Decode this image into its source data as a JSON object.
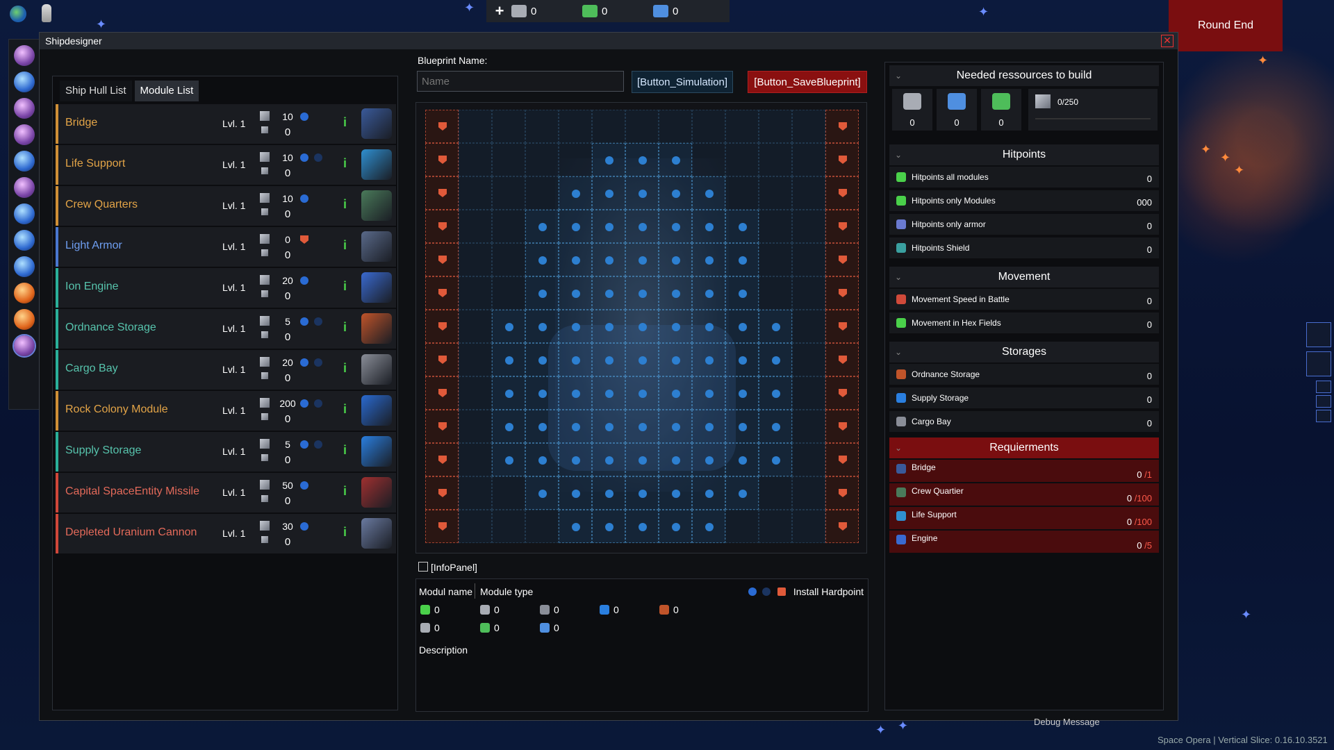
{
  "topbar": {
    "resources": [
      {
        "name": "metal",
        "value": "0",
        "color": "#a8acb4"
      },
      {
        "name": "biomass",
        "value": "0",
        "color": "#4ebd5a"
      },
      {
        "name": "crystal",
        "value": "0",
        "color": "#4f8fe0"
      }
    ],
    "round_end": "Round End"
  },
  "window": {
    "title": "Shipdesigner"
  },
  "tabs": [
    "Ship Hull List",
    "Module List"
  ],
  "modules": [
    {
      "name": "Bridge",
      "level": "Lvl. 1",
      "cost": "10",
      "count": "0",
      "style": "gold",
      "hp": "dot1",
      "thumb": "#3a5a9a"
    },
    {
      "name": "Life Support",
      "level": "Lvl. 1",
      "cost": "10",
      "count": "0",
      "style": "gold",
      "hp": "dot2",
      "thumb": "#2f8fd0"
    },
    {
      "name": "Crew Quarters",
      "level": "Lvl. 1",
      "cost": "10",
      "count": "0",
      "style": "gold",
      "hp": "dot1",
      "thumb": "#4a7a5a"
    },
    {
      "name": "Light Armor",
      "level": "Lvl. 1",
      "cost": "0",
      "count": "0",
      "style": "blue",
      "hp": "shield",
      "thumb": "#5a6a8a"
    },
    {
      "name": "Ion Engine",
      "level": "Lvl. 1",
      "cost": "20",
      "count": "0",
      "style": "teal",
      "hp": "dot1",
      "thumb": "#3a6ad0"
    },
    {
      "name": "Ordnance Storage",
      "level": "Lvl. 1",
      "cost": "5",
      "count": "0",
      "style": "teal",
      "hp": "dot2",
      "thumb": "#c0542a"
    },
    {
      "name": "Cargo Bay",
      "level": "Lvl. 1",
      "cost": "20",
      "count": "0",
      "style": "teal",
      "hp": "dot2",
      "thumb": "#8a8e98"
    },
    {
      "name": "Rock Colony Module",
      "level": "Lvl. 1",
      "cost": "200",
      "count": "0",
      "style": "gold",
      "hp": "dot2",
      "thumb": "#2a6ad0"
    },
    {
      "name": "Supply Storage",
      "level": "Lvl. 1",
      "cost": "5",
      "count": "0",
      "style": "teal",
      "hp": "dot2",
      "thumb": "#2a7fe0"
    },
    {
      "name": "Capital SpaceEntity Missile",
      "level": "Lvl. 1",
      "cost": "50",
      "count": "0",
      "style": "red",
      "hp": "dot1",
      "thumb": "#a03030"
    },
    {
      "name": "Depleted Uranium Cannon",
      "level": "Lvl. 1",
      "cost": "30",
      "count": "0",
      "style": "red",
      "hp": "dot1",
      "thumb": "#6a7aa0"
    }
  ],
  "blueprint": {
    "label": "Blueprint Name:",
    "placeholder": "Name",
    "simulation_button": "[Button_Simulation]",
    "save_button": "[Button_SaveBlueprint]"
  },
  "info_panel": {
    "title": "[InfoPanel]",
    "col_name": "Modul name",
    "col_type": "Module type",
    "hardpoint": "Install Hardpoint",
    "stats_row1": [
      "0",
      "0",
      "0",
      "0",
      "0"
    ],
    "stats_row2": [
      "0",
      "0",
      "0"
    ],
    "description": "Description"
  },
  "right_panel": {
    "needed_title": "Needed ressources to build",
    "needed": [
      "0",
      "0",
      "0"
    ],
    "capacity": "0/250",
    "sections": [
      {
        "title": "Hitpoints",
        "rows": [
          {
            "label": "Hitpoints all modules",
            "value": "0",
            "icon_color": "#4ad04a"
          },
          {
            "label": "Hitpoints only Modules",
            "value": "000",
            "icon_color": "#4ad04a"
          },
          {
            "label": "Hitpoints only armor",
            "value": "0",
            "icon_color": "#6a7ad0"
          },
          {
            "label": "Hitpoints Shield",
            "value": "0",
            "icon_color": "#3aa0a0"
          }
        ]
      },
      {
        "title": "Movement",
        "rows": [
          {
            "label": "Movement Speed in Battle",
            "value": "0",
            "icon_color": "#d04a3a"
          },
          {
            "label": "Movement in Hex Fields",
            "value": "0",
            "icon_color": "#4ad04a"
          }
        ]
      },
      {
        "title": "Storages",
        "rows": [
          {
            "label": "Ordnance Storage",
            "value": "0",
            "icon_color": "#c0542a"
          },
          {
            "label": "Supply Storage",
            "value": "0",
            "icon_color": "#2a7fe0"
          },
          {
            "label": "Cargo Bay",
            "value": "0",
            "icon_color": "#8a8e98"
          }
        ]
      }
    ],
    "requirements_title": "Requierments",
    "requirements": [
      {
        "label": "Bridge",
        "value": "0",
        "max": "/1",
        "icon_color": "#3a5a9a"
      },
      {
        "label": "Crew Quartier",
        "value": "0",
        "max": "/100",
        "icon_color": "#4a7a5a"
      },
      {
        "label": "Life Support",
        "value": "0",
        "max": "/100",
        "icon_color": "#2f8fd0"
      },
      {
        "label": "Engine",
        "value": "0",
        "max": "/5",
        "icon_color": "#3a6ad0"
      }
    ]
  },
  "footer": {
    "debug": "Debug Message",
    "version": "Space Opera | Vertical Slice: 0.16.10.3521"
  }
}
